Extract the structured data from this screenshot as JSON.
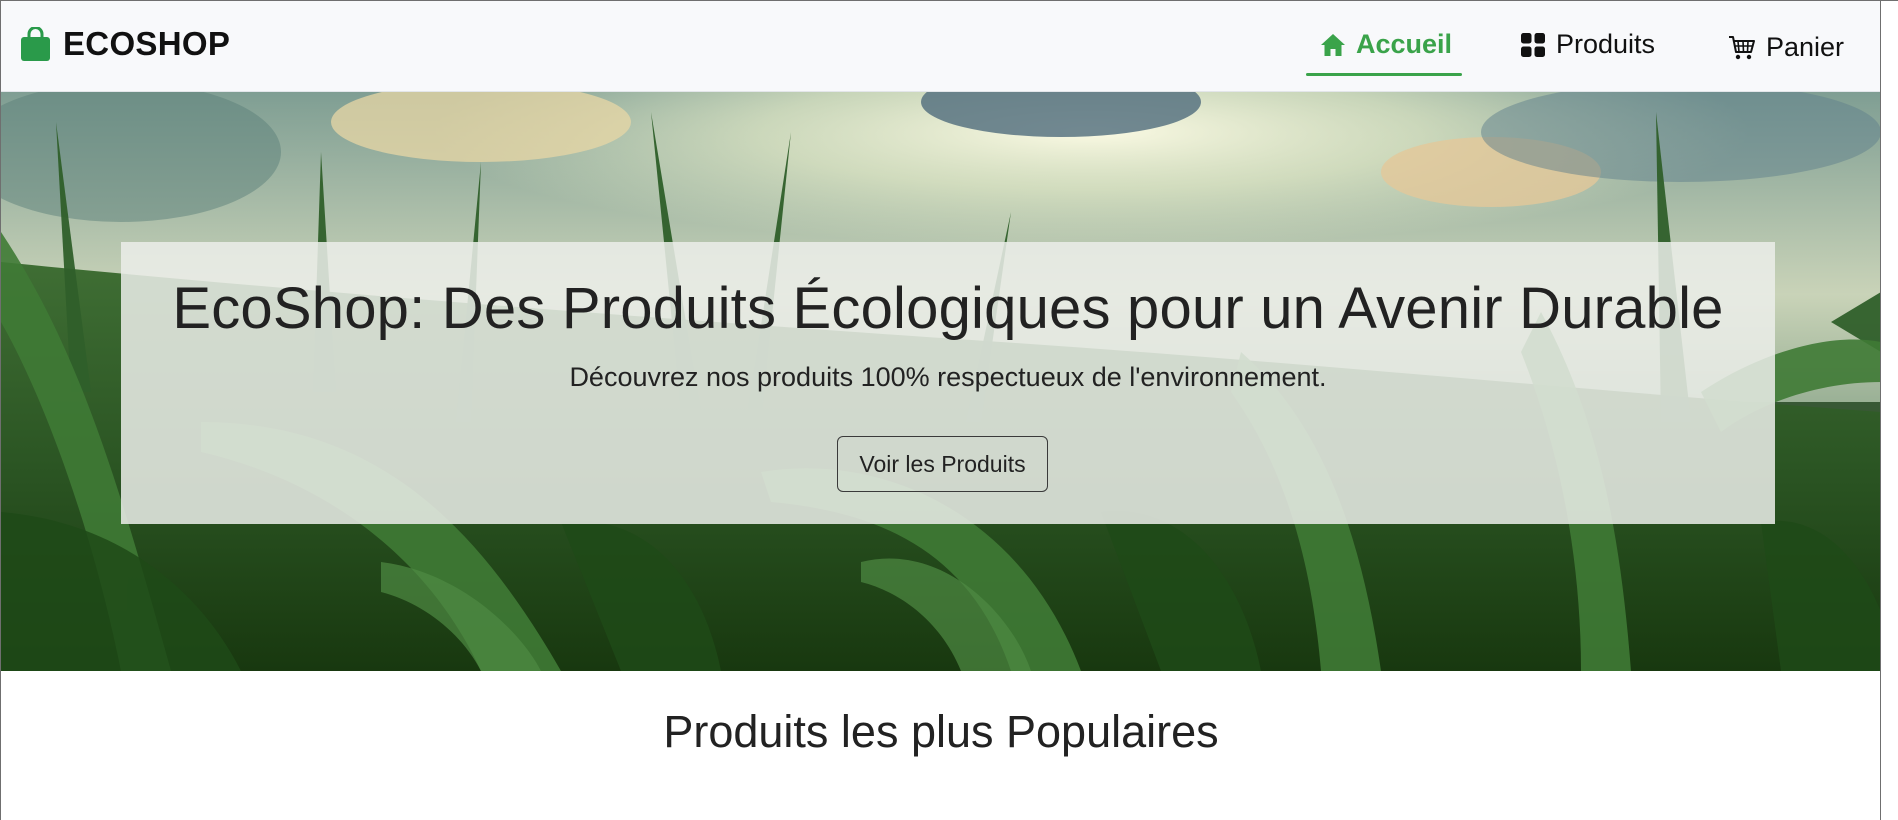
{
  "brand": {
    "name": "ECOSHOP",
    "icon": "shopping-bag-icon",
    "icon_color": "#2a9a4a"
  },
  "nav": {
    "items": [
      {
        "label": "Accueil",
        "icon": "home-icon",
        "active": true
      },
      {
        "label": "Produits",
        "icon": "grid-icon",
        "active": false
      },
      {
        "label": "Panier",
        "icon": "cart-icon",
        "active": false
      }
    ],
    "active_color": "#3aa34a"
  },
  "hero": {
    "title": "EcoShop: Des Produits Écologiques pour un Avenir Durable",
    "subtitle": "Découvrez nos produits 100% respectueux de l'environnement.",
    "button_label": "Voir les Produits"
  },
  "section": {
    "title": "Produits les plus Populaires"
  }
}
